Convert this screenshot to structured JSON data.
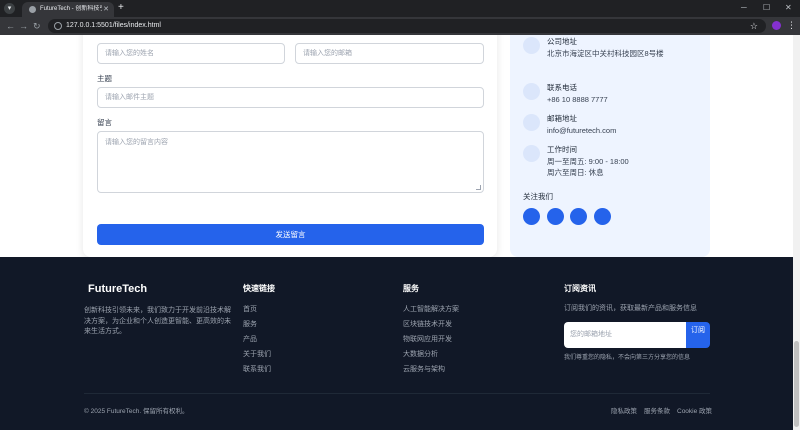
{
  "browser": {
    "tab_title": "FutureTech - 创新科技引领未来",
    "url": "127.0.0.1:5501/files/index.html"
  },
  "form": {
    "name_placeholder": "请输入您的姓名",
    "email_placeholder": "请输入您的邮箱",
    "subject_label": "主题",
    "subject_placeholder": "请输入邮件主题",
    "message_label": "留言",
    "message_placeholder": "请输入您的留言内容",
    "submit_label": "发送留言"
  },
  "contact": {
    "items": [
      {
        "title": "公司地址",
        "lines": [
          "北京市海淀区中关村科技园区8号楼"
        ]
      },
      {
        "title": "联系电话",
        "lines": [
          "+86 10 8888 7777"
        ]
      },
      {
        "title": "邮箱地址",
        "lines": [
          "info@futuretech.com"
        ]
      },
      {
        "title": "工作时间",
        "lines": [
          "周一至周五: 9:00 - 18:00",
          "周六至周日: 休息"
        ]
      }
    ],
    "follow_label": "关注我们"
  },
  "footer": {
    "brand": "FutureTech",
    "description": "创新科技引领未来，我们致力于开发前沿技术解决方案，为企业和个人创造更智能、更高效的未来生活方式。",
    "quick_links": {
      "title": "快速链接",
      "items": [
        "首页",
        "服务",
        "产品",
        "关于我们",
        "联系我们"
      ]
    },
    "services": {
      "title": "服务",
      "items": [
        "人工智能解决方案",
        "区块链技术开发",
        "物联网应用开发",
        "大数据分析",
        "云服务与架构"
      ]
    },
    "newsletter": {
      "title": "订阅资讯",
      "description": "订阅我们的资讯，获取最新产品和服务信息",
      "email_placeholder": "您的邮箱地址",
      "button_label": "订阅",
      "privacy_note": "我们尊重您的隐私，不会向第三方分享您的信息"
    },
    "copyright": "© 2025 FutureTech. 保留所有权利。",
    "legal_links": [
      "隐私政策",
      "服务条款",
      "Cookie 政策"
    ]
  }
}
